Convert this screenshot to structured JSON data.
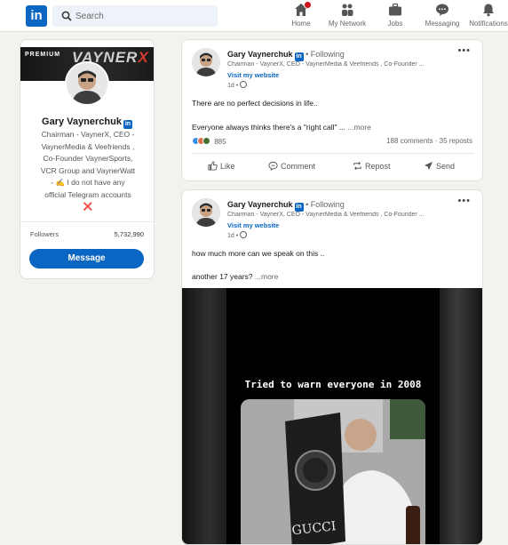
{
  "nav": {
    "logo": "in",
    "search_placeholder": "Search",
    "items": [
      {
        "label": "Home",
        "icon": "home-icon"
      },
      {
        "label": "My Network",
        "icon": "network-icon"
      },
      {
        "label": "Jobs",
        "icon": "briefcase-icon"
      },
      {
        "label": "Messaging",
        "icon": "message-icon"
      },
      {
        "label": "Notifications",
        "icon": "bell-icon"
      }
    ]
  },
  "profile": {
    "cover_premium": "PREMIUM",
    "cover_brand": "VAYNER",
    "cover_brand_x": "X",
    "name": "Gary Vaynerchuk",
    "headline_lines": [
      "Chairman - VaynerX, CEO -",
      "VaynerMedia & Veefriends ,",
      "Co-Founder VaynerSports,",
      "VCR Group and VaynerWatt",
      "- ✍️ I do not have any",
      "official Telegram accounts",
      "❌"
    ],
    "followers_label": "Followers",
    "followers_count": "5,732,990",
    "message_button": "Message"
  },
  "posts": [
    {
      "author": "Gary Vaynerchuk",
      "follow": "• Following",
      "subheadline": "Chairman - VaynerX, CEO - VaynerMedia & Veefriends , Co-Founder ...",
      "website": "Visit my website",
      "time": "1d •",
      "text1": "There are no perfect decisions in life..",
      "text2": "Everyone always thinks there's a \"right call\" ...",
      "more": "...more",
      "reaction_count": "885",
      "comments": "188 comments",
      "reposts": "35 reposts",
      "actions": [
        "Like",
        "Comment",
        "Repost",
        "Send"
      ]
    },
    {
      "author": "Gary Vaynerchuk",
      "follow": "• Following",
      "subheadline": "Chairman - VaynerX, CEO - VaynerMedia & Veefriends , Co-Founder ...",
      "website": "Visit my website",
      "time": "1d •",
      "text1": "how much more can we speak on this ..",
      "text2": "another 17 years?",
      "more": "...more",
      "video_caption": "Tried to warn everyone in 2008"
    }
  ],
  "colors": {
    "linkedin_blue": "#0a66c2",
    "background": "#f4f2ee",
    "notification_red": "#cc1016"
  }
}
